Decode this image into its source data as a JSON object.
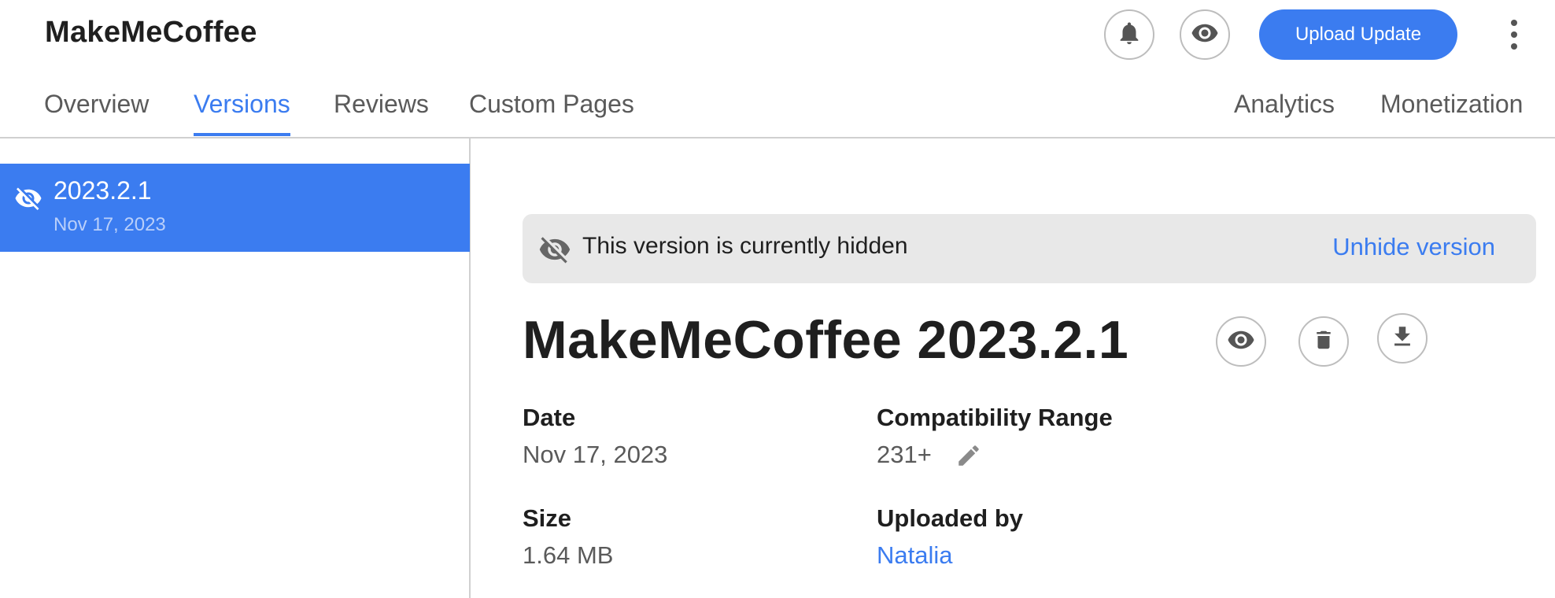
{
  "header": {
    "title": "MakeMeCoffee",
    "upload_label": "Upload Update",
    "icons": [
      "bell-icon",
      "eye-icon",
      "more-vertical-icon"
    ]
  },
  "tabs": {
    "left": [
      {
        "label": "Overview",
        "active": false
      },
      {
        "label": "Versions",
        "active": true
      },
      {
        "label": "Reviews",
        "active": false
      },
      {
        "label": "Custom Pages",
        "active": false
      }
    ],
    "right": [
      {
        "label": "Analytics",
        "active": false
      },
      {
        "label": "Monetization",
        "active": false
      }
    ]
  },
  "sidebar": {
    "versions": [
      {
        "name": "2023.2.1",
        "date": "Nov 17, 2023",
        "hidden": true,
        "selected": true
      }
    ]
  },
  "main": {
    "banner": {
      "text": "This version is currently hidden",
      "action": "Unhide version"
    },
    "title": "MakeMeCoffee 2023.2.1",
    "actions": [
      "eye-icon",
      "trash-icon",
      "download-icon"
    ],
    "fields": {
      "date_label": "Date",
      "date_value": "Nov 17, 2023",
      "compat_label": "Compatibility Range",
      "compat_value": "231+",
      "size_label": "Size",
      "size_value": "1.64 MB",
      "uploader_label": "Uploaded by",
      "uploader_value": "Natalia"
    }
  },
  "colors": {
    "accent": "#3b7cf0",
    "banner_bg": "#e8e8e8",
    "text": "#1f1f1f",
    "muted": "#5a5a5a"
  }
}
